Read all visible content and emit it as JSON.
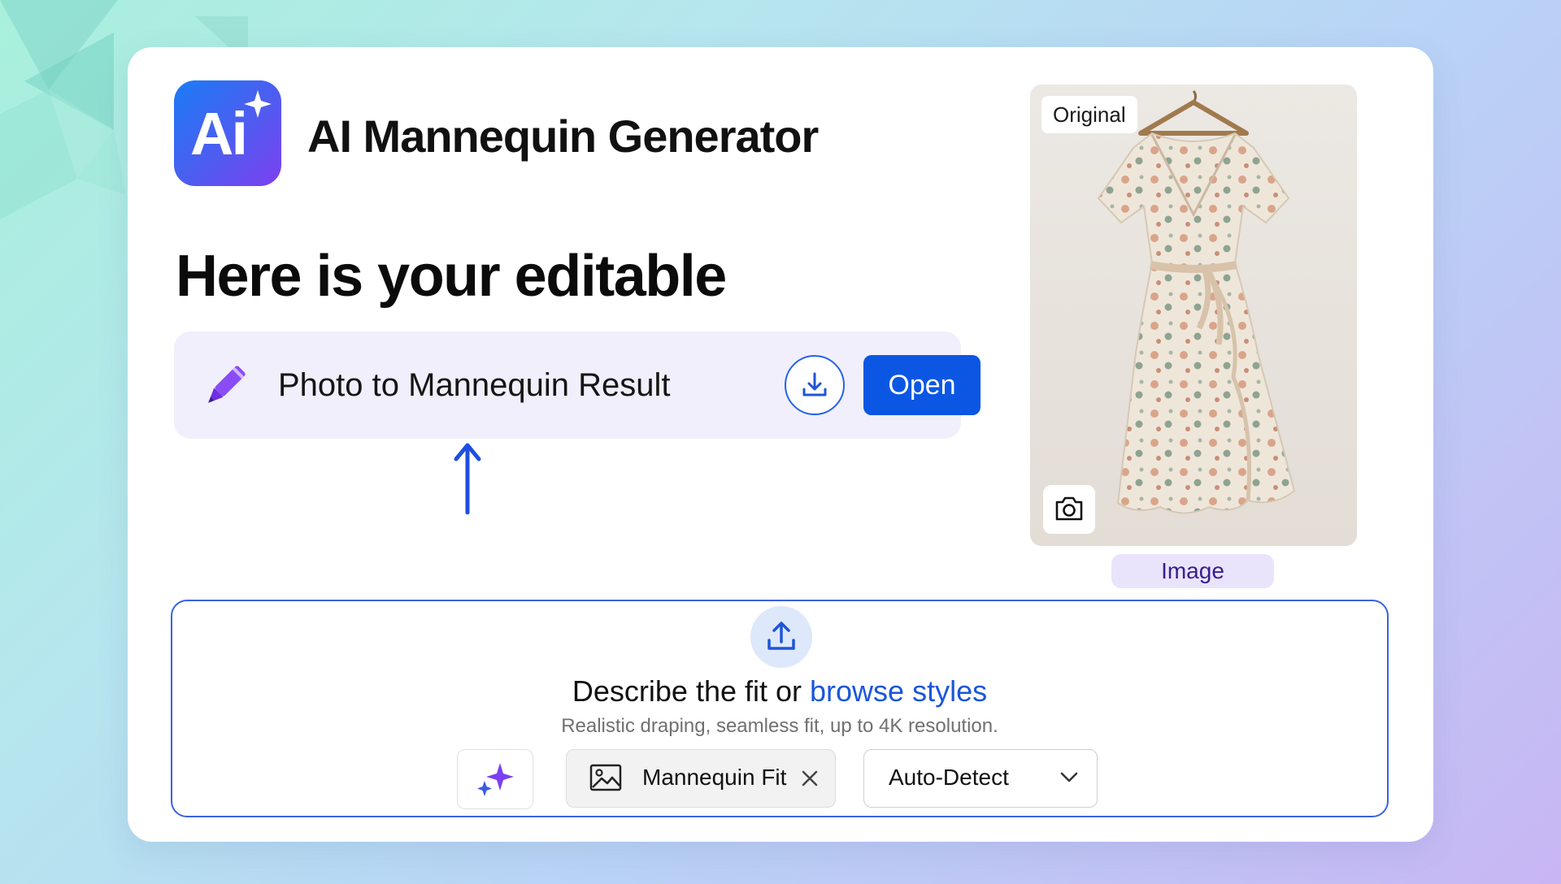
{
  "app": {
    "logo_text": "Ai",
    "title": "AI Mannequin Generator"
  },
  "main": {
    "headline": "Here is your editable",
    "result": {
      "label": "Photo to Mannequin Result",
      "open_label": "Open",
      "icons": [
        "pencil-icon",
        "download-icon"
      ]
    }
  },
  "preview": {
    "tag": "Original",
    "caption": "Image",
    "icons": [
      "camera-icon"
    ]
  },
  "upload": {
    "describe_text": "Describe the fit or",
    "browse_link": "browse styles",
    "subtext": "Realistic draping, seamless fit, up to 4K resolution.",
    "chip_label": "Mannequin Fit",
    "dropdown_value": "Auto-Detect",
    "icons": [
      "upload-icon",
      "sparkle-icon",
      "image-icon",
      "close-icon",
      "chevron-down-icon"
    ]
  },
  "colors": {
    "accent": "#0b57e3",
    "link": "#1a56db",
    "logo_gradient_start": "#1a7cf5",
    "logo_gradient_end": "#7d3ff0",
    "result_bg": "#f1effb",
    "caption_bg": "#e9e4fb",
    "pencil": "#7b3ff2"
  }
}
